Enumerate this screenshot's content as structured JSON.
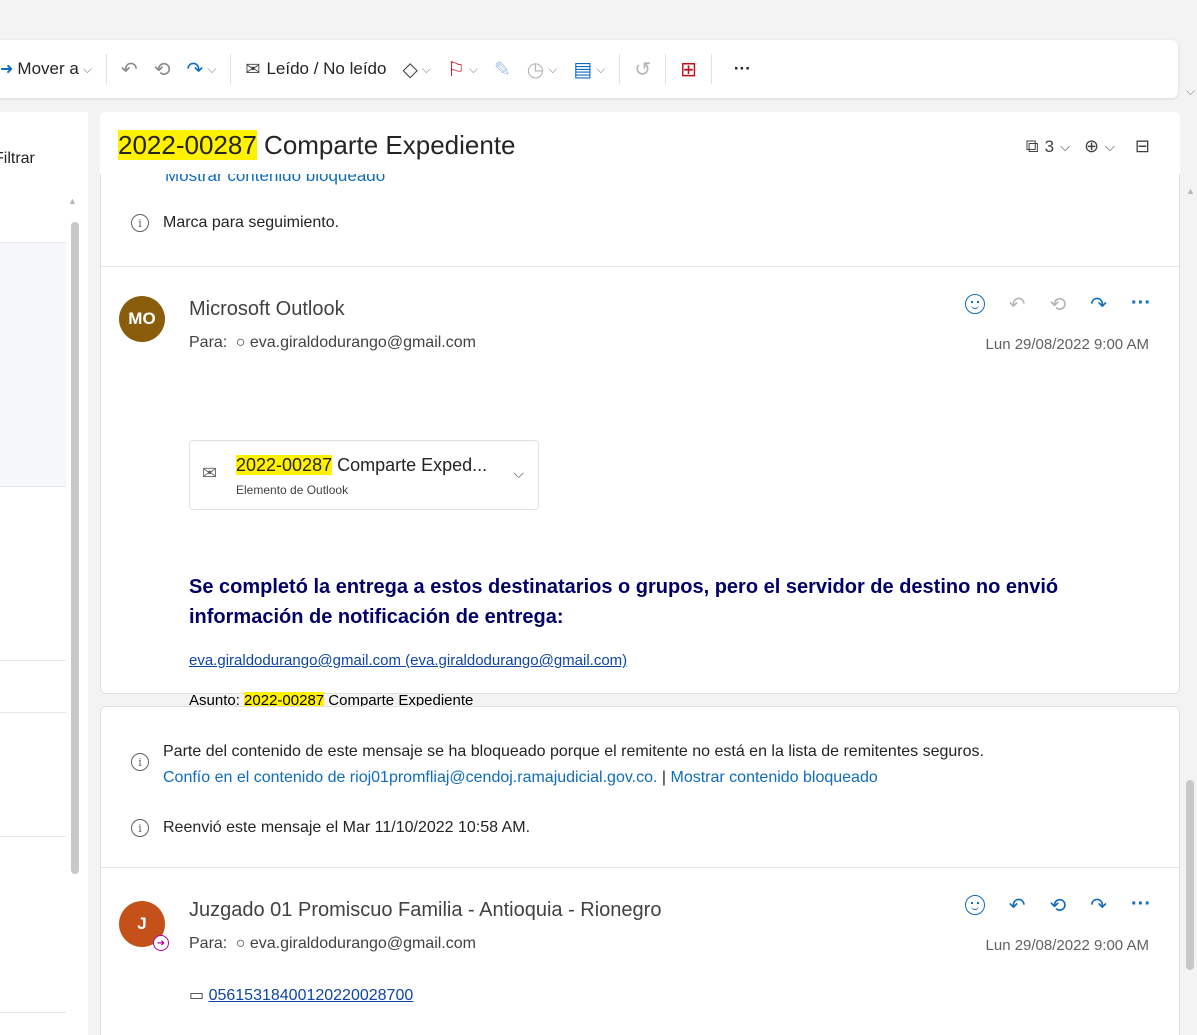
{
  "toolbar": {
    "move_label": "Mover a",
    "read_unread_label": "Leído / No leído",
    "more_label": "···"
  },
  "left": {
    "filter_label": "Filtrar"
  },
  "subject": {
    "highlight": "2022-00287",
    "rest": " Comparte Expediente",
    "attachment_count": "3"
  },
  "message1": {
    "cutoff_text": "Mostrar contenido bloqueado",
    "flag_notice": "Marca para seguimiento.",
    "avatar_initials": "MO",
    "avatar_color": "#8a5d0c",
    "sender": "Microsoft Outlook",
    "to_prefix": "Para:",
    "to_address": "eva.giraldodurango@gmail.com",
    "date": "Lun 29/08/2022 9:00 AM",
    "attachment": {
      "title_highlight": "2022-00287",
      "title_rest": " Comparte Exped...",
      "subtitle": "Elemento de Outlook"
    },
    "notice": "Se completó la entrega a estos destinatarios o grupos, pero el servidor de destino no envió información de notificación de entrega:",
    "recipient_link": "eva.giraldodurango@gmail.com (eva.giraldodurango@gmail.com)",
    "subject_prefix": "Asunto: ",
    "subject_highlight": "2022-00287",
    "subject_rest": " Comparte Expediente"
  },
  "message2": {
    "blocked_notice": "Parte del contenido de este mensaje se ha bloqueado porque el remitente no está en la lista de remitentes seguros.",
    "trust_link": "Confío en el contenido de rioj01promfliaj@cendoj.ramajudicial.gov.co.",
    "separator": " | ",
    "show_blocked_link": "Mostrar contenido bloqueado",
    "forwarded_notice": "Reenvió este mensaje el Mar 11/10/2022 10:58 AM.",
    "avatar_initials": "J",
    "avatar_color": "#c4511a",
    "sender": "Juzgado 01 Promiscuo Familia - Antioquia - Rionegro",
    "to_prefix": "Para:",
    "to_address": "eva.giraldodurango@gmail.com",
    "date": "Lun 29/08/2022 9:00 AM",
    "folder_link": "05615318400120220028700"
  },
  "colors": {
    "accent": "#0f6cbd",
    "highlight": "#fff100",
    "notice_text": "#000066"
  }
}
